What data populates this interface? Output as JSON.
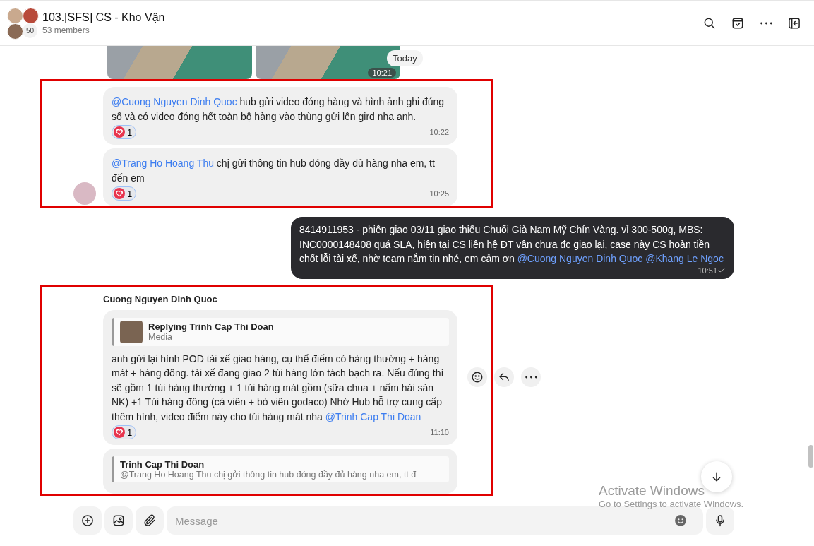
{
  "header": {
    "title": "103.[SFS] CS - Kho Vận",
    "subtitle": "53 members",
    "avatar_count": "50"
  },
  "date_chip": "Today",
  "messages": [
    {
      "kind": "media",
      "time": "10:21"
    },
    {
      "kind": "group",
      "highlighted": true,
      "avatar": true,
      "messages": [
        {
          "segments": [
            {
              "kind": "mention",
              "text": "@Cuong Nguyen Dinh Quoc"
            },
            {
              "kind": "text",
              "text": " hub gửi video đóng hàng và hình ảnh ghi đúng số và có video đóng hết toàn bộ hàng vào thùng gửi lên gird nha anh."
            }
          ],
          "reaction": {
            "count": "1"
          },
          "time": "10:22"
        },
        {
          "segments": [
            {
              "kind": "mention",
              "text": "@Trang Ho Hoang Thu"
            },
            {
              "kind": "text",
              "text": " chị gửi thông tin hub đóng đầy đủ hàng nha em, tt đến em"
            }
          ],
          "reaction": {
            "count": "1"
          },
          "time": "10:25"
        }
      ]
    },
    {
      "kind": "own",
      "segments": [
        {
          "kind": "text",
          "text": "8414911953 - phiên giao 03/11 giao thiếu Chuối Già Nam Mỹ Chín Vàng. vỉ 300-500g, MBS: INC0000148408 quá SLA, hiện tại CS liên hệ ĐT vẫn chưa đc giao lại, case này CS hoàn tiền chốt lỗi tài xế, nhờ team nắm tin nhé, em cảm ơn "
        },
        {
          "kind": "mention",
          "text": "@Cuong Nguyen Dinh Quoc"
        },
        {
          "kind": "mention",
          "text": "@Khang Le Ngoc"
        }
      ],
      "time": "10:51"
    },
    {
      "kind": "group",
      "highlighted": true,
      "avatar": false,
      "sender": "Cuong Nguyen Dinh Quoc",
      "messages": [
        {
          "reply": {
            "title": "Replying Trinh Cap Thi Doan",
            "subtitle": "Media",
            "thumbnail": true
          },
          "segments": [
            {
              "kind": "text",
              "text": "anh gửi lại hình POD tài xế giao hàng, cụ thể điểm có hàng thường + hàng mát + hàng đông. tài xế đang giao 2 túi hàng lớn tách bạch ra. Nếu đúng thì sẽ gồm 1 túi hàng thường + 1 túi hàng mát gồm (sữa chua + nấm hải sản NK) +1 Túi hàng đông (cá viên + bò viên godaco) Nhờ Hub hỗ trợ cung cấp thêm hình, video điểm này cho túi hàng mát nha "
            },
            {
              "kind": "mention",
              "text": "@Trinh Cap Thi Doan"
            }
          ],
          "reaction": {
            "count": "1"
          },
          "time": "11:10",
          "actions": true
        },
        {
          "reply": {
            "title": "Trinh Cap Thi Doan",
            "subtitle": "@Trang Ho Hoang Thu chị gửi thông tin hub đóng đầy đủ hàng nha em, tt đ",
            "thumbnail": false
          }
        }
      ]
    }
  ],
  "composer": {
    "placeholder": "Message"
  },
  "activation": {
    "title": "Activate Windows",
    "subtitle": "Go to Settings to activate Windows."
  }
}
